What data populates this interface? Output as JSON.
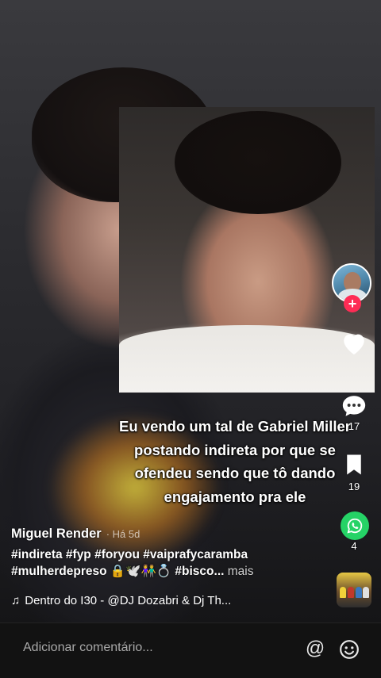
{
  "caption": {
    "lines": [
      "Eu vendo um tal de Gabriel Miller",
      "postando indireta por que se",
      "ofendeu sendo que tô dando",
      "engajamento pra ele"
    ]
  },
  "rail": {
    "comments_count": "17",
    "saves_count": "19",
    "shares_count": "4"
  },
  "post": {
    "author": "Miguel Render",
    "time": "· Há 5d",
    "hashtags_line1": "#indireta #fyp #foryou #vaiprafycaramba",
    "hashtags_line2": "#mulherdepreso 🔒🕊️👫💍 #bisco...",
    "more": "mais"
  },
  "music": {
    "note": "♫",
    "title": "Dentro do I30 - @DJ Dozabri & Dj Th..."
  },
  "comment_bar": {
    "placeholder": "Adicionar comentário...",
    "mention": "@"
  },
  "colors": {
    "like": "#ffffff",
    "follow": "#fe2c55",
    "whatsapp": "#25d366",
    "bar": "#121212"
  }
}
